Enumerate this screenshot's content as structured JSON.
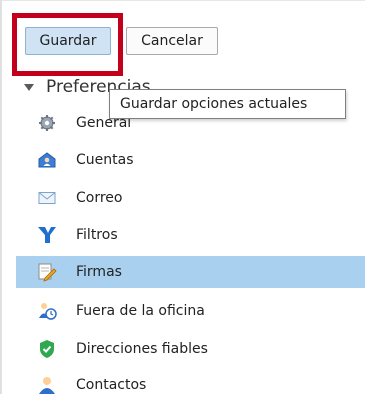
{
  "toolbar": {
    "save_label": "Guardar",
    "cancel_label": "Cancelar"
  },
  "tooltip": {
    "text": "Guardar opciones actuales"
  },
  "tree": {
    "header_label": "Preferencias",
    "items": [
      {
        "label": "General",
        "icon": "gear-icon"
      },
      {
        "label": "Cuentas",
        "icon": "accounts-icon"
      },
      {
        "label": "Correo",
        "icon": "mail-icon"
      },
      {
        "label": "Filtros",
        "icon": "filter-icon"
      },
      {
        "label": "Firmas",
        "icon": "signature-icon",
        "selected": true
      },
      {
        "label": "Fuera de la oficina",
        "icon": "out-of-office-icon"
      },
      {
        "label": "Direcciones fiables",
        "icon": "shield-check-icon"
      },
      {
        "label": "Contactos",
        "icon": "contact-icon"
      }
    ]
  },
  "colors": {
    "selection": "#a9d1ef",
    "save_button": "#cfe3f4",
    "highlight_box": "#c2001b"
  }
}
